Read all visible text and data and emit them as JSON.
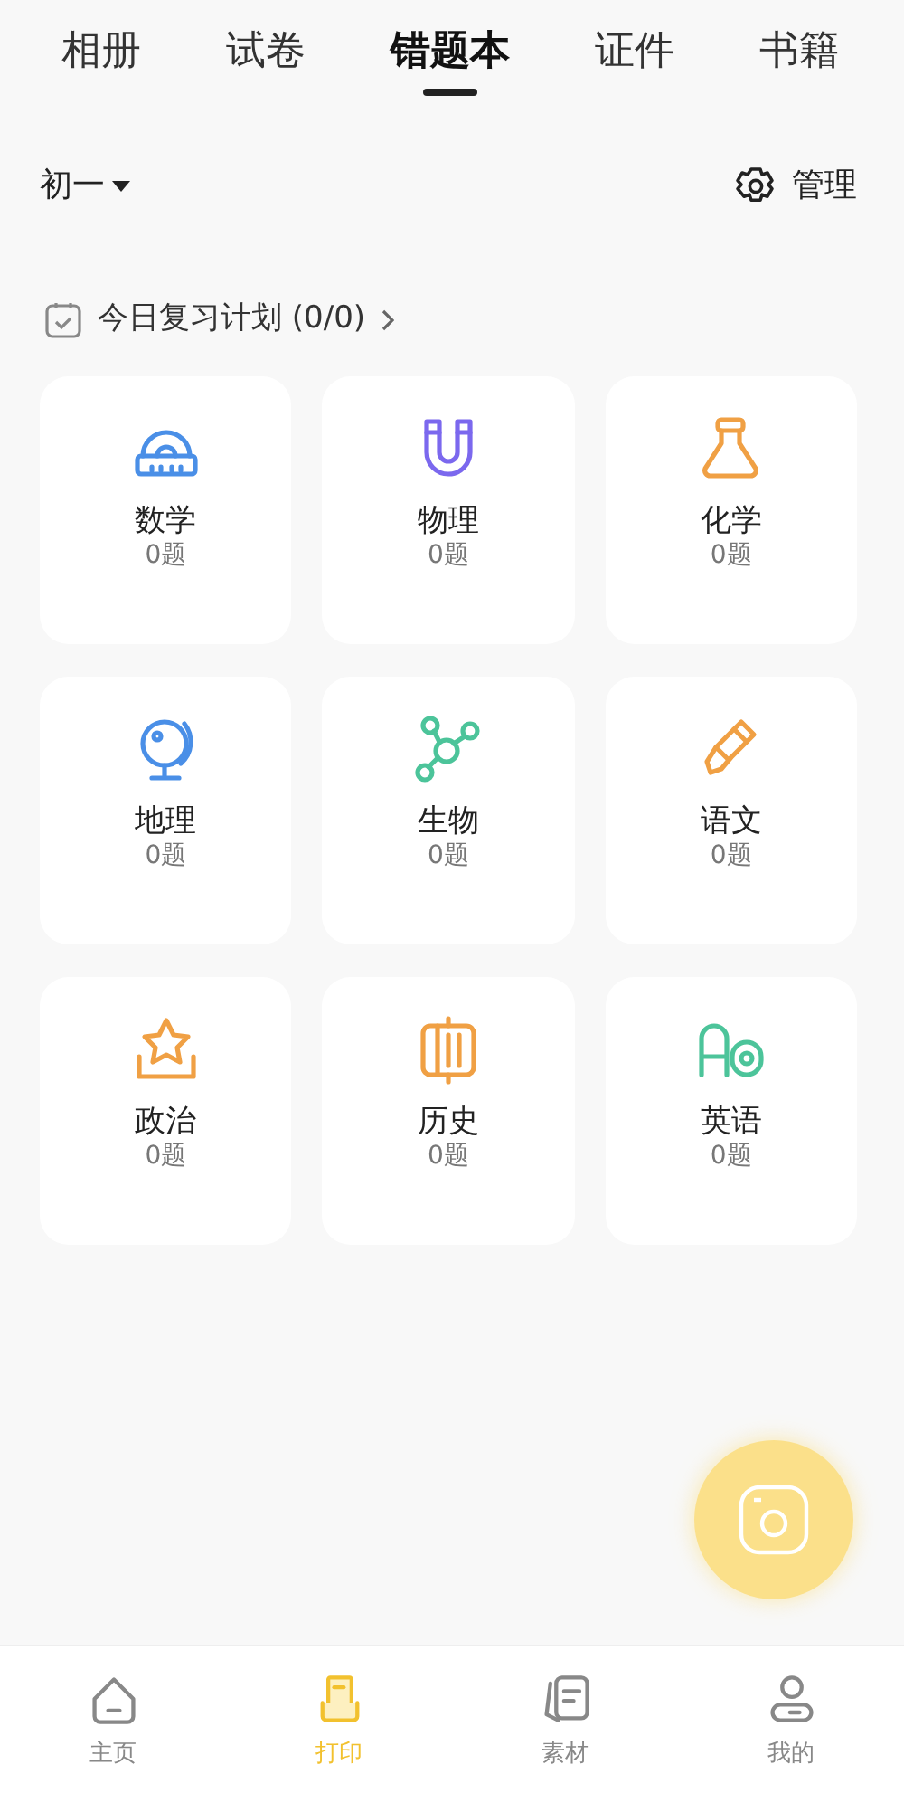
{
  "tabs": [
    {
      "label": "相册",
      "selected": false
    },
    {
      "label": "试卷",
      "selected": false
    },
    {
      "label": "错题本",
      "selected": true
    },
    {
      "label": "证件",
      "selected": false
    },
    {
      "label": "书籍",
      "selected": false
    }
  ],
  "grade": "初一",
  "manage": "管理",
  "plan": "今日复习计划 (0/0)",
  "subjects": [
    {
      "name": "数学",
      "count": "0题",
      "color": "#4a8fe7"
    },
    {
      "name": "物理",
      "count": "0题",
      "color": "#7b68ee"
    },
    {
      "name": "化学",
      "count": "0题",
      "color": "#f0a044"
    },
    {
      "name": "地理",
      "count": "0题",
      "color": "#4a8fe7"
    },
    {
      "name": "生物",
      "count": "0题",
      "color": "#4cc49a"
    },
    {
      "name": "语文",
      "count": "0题",
      "color": "#f0a044"
    },
    {
      "name": "政治",
      "count": "0题",
      "color": "#f0a044"
    },
    {
      "name": "历史",
      "count": "0题",
      "color": "#f0a044"
    },
    {
      "name": "英语",
      "count": "0题",
      "color": "#4cc49a"
    }
  ],
  "nav": [
    {
      "label": "主页",
      "selected": false
    },
    {
      "label": "打印",
      "selected": true
    },
    {
      "label": "素材",
      "selected": false
    },
    {
      "label": "我的",
      "selected": false
    }
  ]
}
